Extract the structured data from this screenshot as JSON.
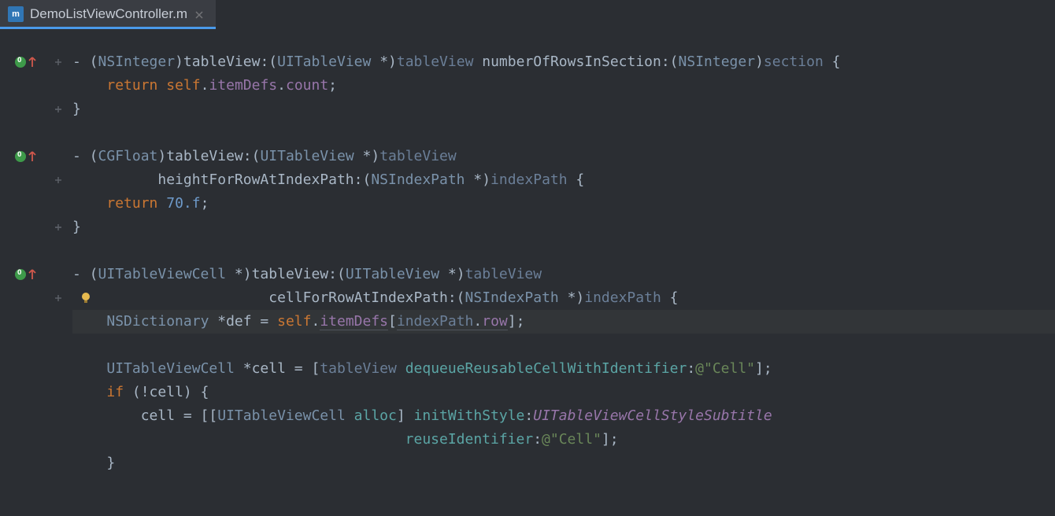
{
  "tab": {
    "filename": "DemoListViewController.m",
    "icon_label": "m"
  },
  "gutter": {
    "overrides": [
      0,
      4,
      9
    ],
    "folds": [
      0,
      2,
      5,
      7,
      10
    ],
    "bulb_line": 10
  },
  "code": {
    "lines": [
      [
        {
          "t": "- (",
          "c": "punct"
        },
        {
          "t": "NSInteger",
          "c": "type"
        },
        {
          "t": ")",
          "c": "punct"
        },
        {
          "t": "tableView",
          "c": "method"
        },
        {
          "t": ":(",
          "c": "punct"
        },
        {
          "t": "UITableView",
          "c": "type"
        },
        {
          "t": " *)",
          "c": "punct"
        },
        {
          "t": "tableView",
          "c": "param"
        },
        {
          "t": " numberOfRowsInSection",
          "c": "method"
        },
        {
          "t": ":(",
          "c": "punct"
        },
        {
          "t": "NSInteger",
          "c": "type"
        },
        {
          "t": ")",
          "c": "punct"
        },
        {
          "t": "section",
          "c": "param"
        },
        {
          "t": " {",
          "c": "punct"
        }
      ],
      [
        {
          "t": "    ",
          "c": ""
        },
        {
          "t": "return",
          "c": "kw"
        },
        {
          "t": " ",
          "c": ""
        },
        {
          "t": "self",
          "c": "self-kw"
        },
        {
          "t": ".",
          "c": "punct"
        },
        {
          "t": "itemDefs",
          "c": "prop"
        },
        {
          "t": ".",
          "c": "punct"
        },
        {
          "t": "count",
          "c": "prop"
        },
        {
          "t": ";",
          "c": "punct"
        }
      ],
      [
        {
          "t": "}",
          "c": "punct"
        }
      ],
      [
        {
          "t": "",
          "c": ""
        }
      ],
      [
        {
          "t": "- (",
          "c": "punct"
        },
        {
          "t": "CGFloat",
          "c": "type"
        },
        {
          "t": ")",
          "c": "punct"
        },
        {
          "t": "tableView",
          "c": "method"
        },
        {
          "t": ":(",
          "c": "punct"
        },
        {
          "t": "UITableView",
          "c": "type"
        },
        {
          "t": " *)",
          "c": "punct"
        },
        {
          "t": "tableView",
          "c": "param"
        }
      ],
      [
        {
          "t": "          ",
          "c": ""
        },
        {
          "t": "heightForRowAtIndexPath",
          "c": "method"
        },
        {
          "t": ":(",
          "c": "punct"
        },
        {
          "t": "NSIndexPath",
          "c": "type"
        },
        {
          "t": " *)",
          "c": "punct"
        },
        {
          "t": "indexPath",
          "c": "param"
        },
        {
          "t": " {",
          "c": "punct"
        }
      ],
      [
        {
          "t": "    ",
          "c": ""
        },
        {
          "t": "return",
          "c": "kw"
        },
        {
          "t": " ",
          "c": ""
        },
        {
          "t": "70.f",
          "c": "num"
        },
        {
          "t": ";",
          "c": "punct"
        }
      ],
      [
        {
          "t": "}",
          "c": "punct"
        }
      ],
      [
        {
          "t": "",
          "c": ""
        }
      ],
      [
        {
          "t": "- (",
          "c": "punct"
        },
        {
          "t": "UITableViewCell",
          "c": "type"
        },
        {
          "t": " *)",
          "c": "punct"
        },
        {
          "t": "tableView",
          "c": "method"
        },
        {
          "t": ":(",
          "c": "punct"
        },
        {
          "t": "UITableView",
          "c": "type"
        },
        {
          "t": " *)",
          "c": "punct"
        },
        {
          "t": "tableView",
          "c": "param"
        }
      ],
      [
        {
          "t": "                       ",
          "c": ""
        },
        {
          "t": "cellForRowAtIndexPath",
          "c": "method"
        },
        {
          "t": ":(",
          "c": "punct"
        },
        {
          "t": "NSIndexPath",
          "c": "type"
        },
        {
          "t": " *)",
          "c": "punct"
        },
        {
          "t": "indexPath",
          "c": "param"
        },
        {
          "t": " {",
          "c": "punct"
        }
      ],
      [
        {
          "t": "    ",
          "c": ""
        },
        {
          "t": "NSDictionary",
          "c": "type"
        },
        {
          "t": " *def = ",
          "c": "punct"
        },
        {
          "t": "self",
          "c": "self-kw"
        },
        {
          "t": ".",
          "c": "punct"
        },
        {
          "t": "itemDefs",
          "c": "prop underline-hint"
        },
        {
          "t": "[",
          "c": "punct"
        },
        {
          "t": "indexPath",
          "c": "param underline-hint"
        },
        {
          "t": ".",
          "c": "punct underline-hint"
        },
        {
          "t": "row",
          "c": "prop underline-hint"
        },
        {
          "t": "]",
          "c": "punct"
        },
        {
          "t": ";",
          "c": "punct"
        }
      ],
      [
        {
          "t": "",
          "c": ""
        }
      ],
      [
        {
          "t": "    ",
          "c": ""
        },
        {
          "t": "UITableViewCell",
          "c": "type"
        },
        {
          "t": " *cell = [",
          "c": "punct"
        },
        {
          "t": "tableView",
          "c": "param"
        },
        {
          "t": " ",
          "c": ""
        },
        {
          "t": "dequeueReusableCellWithIdentifier",
          "c": "obj-method"
        },
        {
          "t": ":",
          "c": "punct"
        },
        {
          "t": "@\"Cell\"",
          "c": "str"
        },
        {
          "t": "];",
          "c": "punct"
        }
      ],
      [
        {
          "t": "    ",
          "c": ""
        },
        {
          "t": "if",
          "c": "kw"
        },
        {
          "t": " (!cell) {",
          "c": "punct"
        }
      ],
      [
        {
          "t": "        cell = [[",
          "c": "punct"
        },
        {
          "t": "UITableViewCell",
          "c": "type"
        },
        {
          "t": " ",
          "c": ""
        },
        {
          "t": "alloc",
          "c": "obj-method"
        },
        {
          "t": "] ",
          "c": "punct"
        },
        {
          "t": "initWithStyle",
          "c": "obj-method"
        },
        {
          "t": ":",
          "c": "punct"
        },
        {
          "t": "UITableViewCellStyleSubtitle",
          "c": "const-enum"
        }
      ],
      [
        {
          "t": "                                       ",
          "c": ""
        },
        {
          "t": "reuseIdentifier",
          "c": "obj-method"
        },
        {
          "t": ":",
          "c": "punct"
        },
        {
          "t": "@\"Cell\"",
          "c": "str"
        },
        {
          "t": "];",
          "c": "punct"
        }
      ],
      [
        {
          "t": "    }",
          "c": "punct"
        }
      ]
    ],
    "highlighted_line": 11
  }
}
